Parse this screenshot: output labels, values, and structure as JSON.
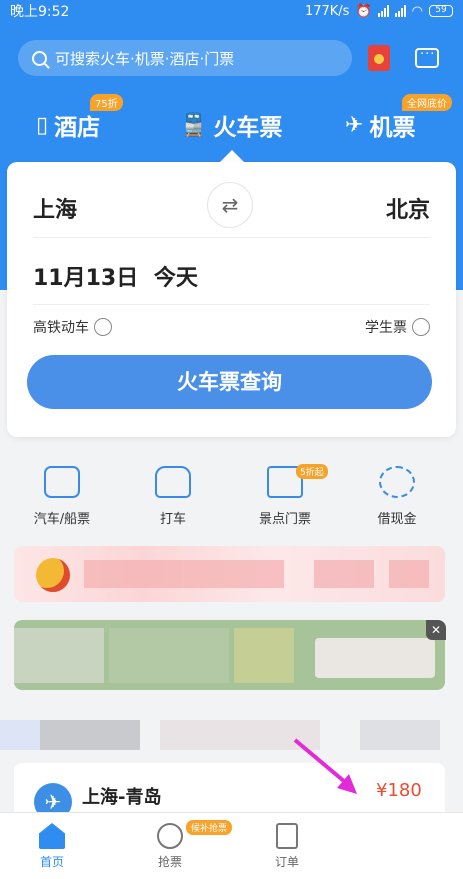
{
  "status_bar": {
    "time": "晚上9:52",
    "network_speed": "177K/s",
    "battery": "59"
  },
  "search": {
    "placeholder": "可搜索火车·机票·酒店·门票"
  },
  "categories": [
    {
      "label": "酒店",
      "badge": "75折"
    },
    {
      "label": "火车票",
      "badge": ""
    },
    {
      "label": "机票",
      "badge": "全网底价"
    }
  ],
  "booking": {
    "from_city": "上海",
    "to_city": "北京",
    "date": "11月13日",
    "day": "今天",
    "option_highspeed": "高铁动车",
    "option_student": "学生票",
    "search_button": "火车票查询"
  },
  "services": [
    {
      "label": "汽车/船票",
      "badge": ""
    },
    {
      "label": "打车",
      "badge": ""
    },
    {
      "label": "景点门票",
      "badge": "5折起"
    },
    {
      "label": "借现金",
      "badge": ""
    }
  ],
  "route_card": {
    "title": "上海-青岛",
    "price": "¥180"
  },
  "tab_bar": {
    "items": [
      {
        "label": "首页"
      },
      {
        "label": "抢票",
        "badge": "候补抢票"
      },
      {
        "label": "订单"
      }
    ]
  },
  "colors": {
    "primary": "#2f8cf0",
    "accent_orange": "#f7a22a",
    "price_red": "#f04b32",
    "annotation_magenta": "#e22bd8"
  }
}
